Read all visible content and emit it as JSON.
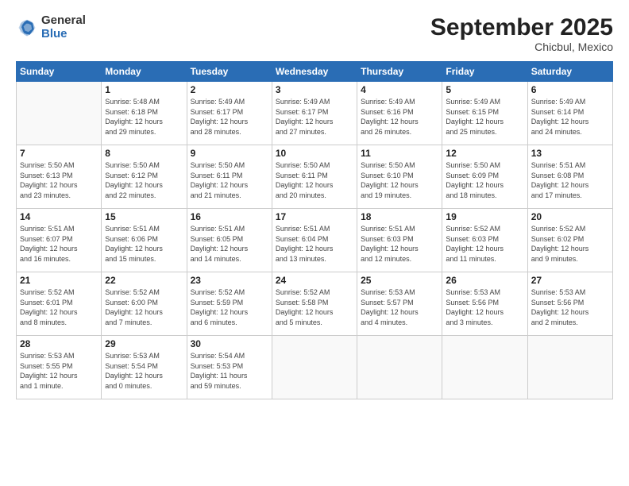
{
  "logo": {
    "general": "General",
    "blue": "Blue"
  },
  "title": "September 2025",
  "subtitle": "Chicbul, Mexico",
  "weekdays": [
    "Sunday",
    "Monday",
    "Tuesday",
    "Wednesday",
    "Thursday",
    "Friday",
    "Saturday"
  ],
  "weeks": [
    [
      {
        "day": "",
        "detail": ""
      },
      {
        "day": "1",
        "detail": "Sunrise: 5:48 AM\nSunset: 6:18 PM\nDaylight: 12 hours\nand 29 minutes."
      },
      {
        "day": "2",
        "detail": "Sunrise: 5:49 AM\nSunset: 6:17 PM\nDaylight: 12 hours\nand 28 minutes."
      },
      {
        "day": "3",
        "detail": "Sunrise: 5:49 AM\nSunset: 6:17 PM\nDaylight: 12 hours\nand 27 minutes."
      },
      {
        "day": "4",
        "detail": "Sunrise: 5:49 AM\nSunset: 6:16 PM\nDaylight: 12 hours\nand 26 minutes."
      },
      {
        "day": "5",
        "detail": "Sunrise: 5:49 AM\nSunset: 6:15 PM\nDaylight: 12 hours\nand 25 minutes."
      },
      {
        "day": "6",
        "detail": "Sunrise: 5:49 AM\nSunset: 6:14 PM\nDaylight: 12 hours\nand 24 minutes."
      }
    ],
    [
      {
        "day": "7",
        "detail": "Sunrise: 5:50 AM\nSunset: 6:13 PM\nDaylight: 12 hours\nand 23 minutes."
      },
      {
        "day": "8",
        "detail": "Sunrise: 5:50 AM\nSunset: 6:12 PM\nDaylight: 12 hours\nand 22 minutes."
      },
      {
        "day": "9",
        "detail": "Sunrise: 5:50 AM\nSunset: 6:11 PM\nDaylight: 12 hours\nand 21 minutes."
      },
      {
        "day": "10",
        "detail": "Sunrise: 5:50 AM\nSunset: 6:11 PM\nDaylight: 12 hours\nand 20 minutes."
      },
      {
        "day": "11",
        "detail": "Sunrise: 5:50 AM\nSunset: 6:10 PM\nDaylight: 12 hours\nand 19 minutes."
      },
      {
        "day": "12",
        "detail": "Sunrise: 5:50 AM\nSunset: 6:09 PM\nDaylight: 12 hours\nand 18 minutes."
      },
      {
        "day": "13",
        "detail": "Sunrise: 5:51 AM\nSunset: 6:08 PM\nDaylight: 12 hours\nand 17 minutes."
      }
    ],
    [
      {
        "day": "14",
        "detail": "Sunrise: 5:51 AM\nSunset: 6:07 PM\nDaylight: 12 hours\nand 16 minutes."
      },
      {
        "day": "15",
        "detail": "Sunrise: 5:51 AM\nSunset: 6:06 PM\nDaylight: 12 hours\nand 15 minutes."
      },
      {
        "day": "16",
        "detail": "Sunrise: 5:51 AM\nSunset: 6:05 PM\nDaylight: 12 hours\nand 14 minutes."
      },
      {
        "day": "17",
        "detail": "Sunrise: 5:51 AM\nSunset: 6:04 PM\nDaylight: 12 hours\nand 13 minutes."
      },
      {
        "day": "18",
        "detail": "Sunrise: 5:51 AM\nSunset: 6:03 PM\nDaylight: 12 hours\nand 12 minutes."
      },
      {
        "day": "19",
        "detail": "Sunrise: 5:52 AM\nSunset: 6:03 PM\nDaylight: 12 hours\nand 11 minutes."
      },
      {
        "day": "20",
        "detail": "Sunrise: 5:52 AM\nSunset: 6:02 PM\nDaylight: 12 hours\nand 9 minutes."
      }
    ],
    [
      {
        "day": "21",
        "detail": "Sunrise: 5:52 AM\nSunset: 6:01 PM\nDaylight: 12 hours\nand 8 minutes."
      },
      {
        "day": "22",
        "detail": "Sunrise: 5:52 AM\nSunset: 6:00 PM\nDaylight: 12 hours\nand 7 minutes."
      },
      {
        "day": "23",
        "detail": "Sunrise: 5:52 AM\nSunset: 5:59 PM\nDaylight: 12 hours\nand 6 minutes."
      },
      {
        "day": "24",
        "detail": "Sunrise: 5:52 AM\nSunset: 5:58 PM\nDaylight: 12 hours\nand 5 minutes."
      },
      {
        "day": "25",
        "detail": "Sunrise: 5:53 AM\nSunset: 5:57 PM\nDaylight: 12 hours\nand 4 minutes."
      },
      {
        "day": "26",
        "detail": "Sunrise: 5:53 AM\nSunset: 5:56 PM\nDaylight: 12 hours\nand 3 minutes."
      },
      {
        "day": "27",
        "detail": "Sunrise: 5:53 AM\nSunset: 5:56 PM\nDaylight: 12 hours\nand 2 minutes."
      }
    ],
    [
      {
        "day": "28",
        "detail": "Sunrise: 5:53 AM\nSunset: 5:55 PM\nDaylight: 12 hours\nand 1 minute."
      },
      {
        "day": "29",
        "detail": "Sunrise: 5:53 AM\nSunset: 5:54 PM\nDaylight: 12 hours\nand 0 minutes."
      },
      {
        "day": "30",
        "detail": "Sunrise: 5:54 AM\nSunset: 5:53 PM\nDaylight: 11 hours\nand 59 minutes."
      },
      {
        "day": "",
        "detail": ""
      },
      {
        "day": "",
        "detail": ""
      },
      {
        "day": "",
        "detail": ""
      },
      {
        "day": "",
        "detail": ""
      }
    ]
  ]
}
